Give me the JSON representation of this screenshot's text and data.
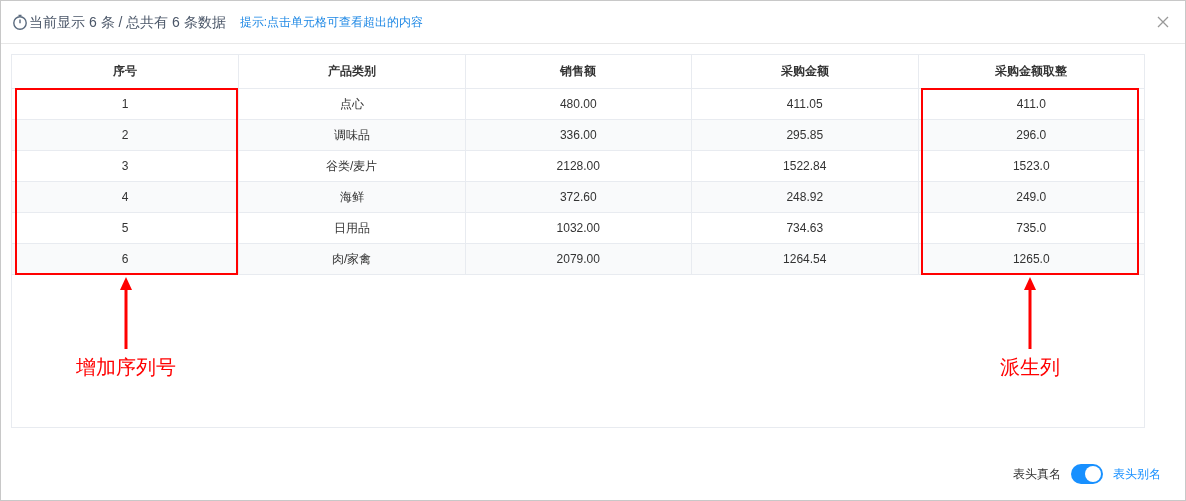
{
  "header": {
    "summary": "当前显示 6 条 / 总共有 6 条数据",
    "hint": "提示:点击单元格可查看超出的内容"
  },
  "table": {
    "columns": [
      {
        "label": "序号",
        "note": "增加序列号"
      },
      {
        "label": "产品类别"
      },
      {
        "label": "销售额"
      },
      {
        "label": "采购金额"
      },
      {
        "label": "采购金额取整",
        "note": "派生列"
      }
    ],
    "rows": [
      [
        "1",
        "点心",
        "480.00",
        "411.05",
        "411.0"
      ],
      [
        "2",
        "调味品",
        "336.00",
        "295.85",
        "296.0"
      ],
      [
        "3",
        "谷类/麦片",
        "2128.00",
        "1522.84",
        "1523.0"
      ],
      [
        "4",
        "海鲜",
        "372.60",
        "248.92",
        "249.0"
      ],
      [
        "5",
        "日用品",
        "1032.00",
        "734.63",
        "735.0"
      ],
      [
        "6",
        "肉/家禽",
        "2079.00",
        "1264.54",
        "1265.0"
      ]
    ]
  },
  "footer": {
    "left_label": "表头真名",
    "toggle_on": true,
    "right_label": "表头别名"
  }
}
